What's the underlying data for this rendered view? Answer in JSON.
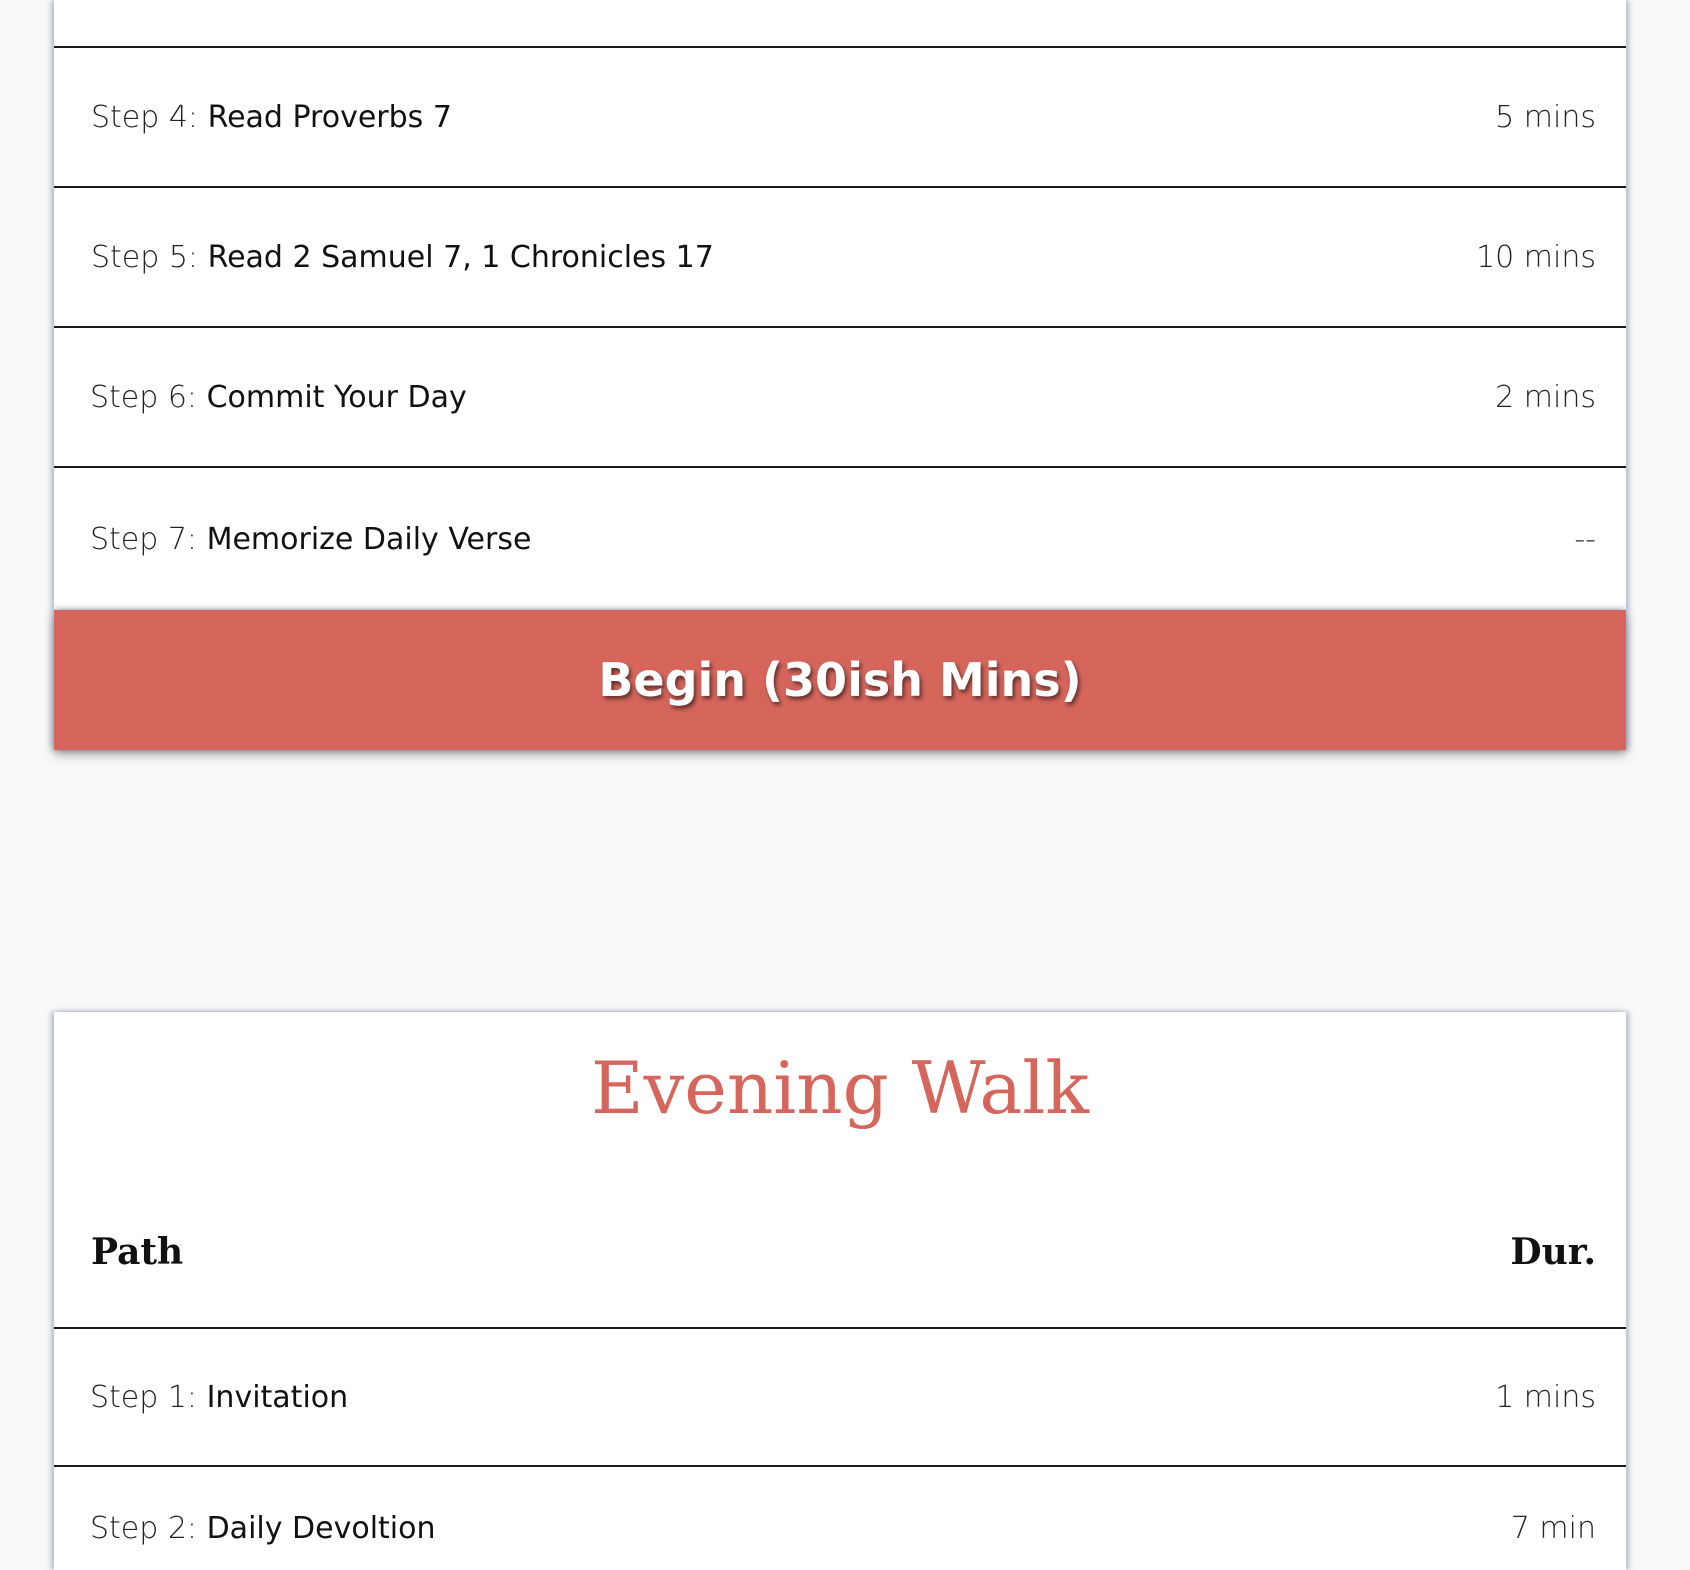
{
  "morning": {
    "steps": [
      {
        "prefix": "Step 4: ",
        "title": "Read Proverbs 7",
        "duration": "5 mins"
      },
      {
        "prefix": "Step 5: ",
        "title": "Read 2 Samuel 7, 1 Chronicles 17",
        "duration": "10 mins"
      },
      {
        "prefix": "Step 6: ",
        "title": "Commit Your Day",
        "duration": "2 mins"
      },
      {
        "prefix": "Step 7: ",
        "title": "Memorize Daily Verse",
        "duration": "--"
      }
    ],
    "begin_label": "Begin (30ish Mins)"
  },
  "evening": {
    "title": "Evening Walk",
    "col_path": "Path",
    "col_duration": "Dur.",
    "steps": [
      {
        "prefix": "Step 1: ",
        "title": "Invitation",
        "duration": "1 mins"
      },
      {
        "prefix": "Step 2: ",
        "title": "Daily Devoltion",
        "duration": "7 min"
      }
    ]
  },
  "colors": {
    "accent": "#d6665c",
    "background": "#f9f9f9",
    "card": "#ffffff"
  }
}
